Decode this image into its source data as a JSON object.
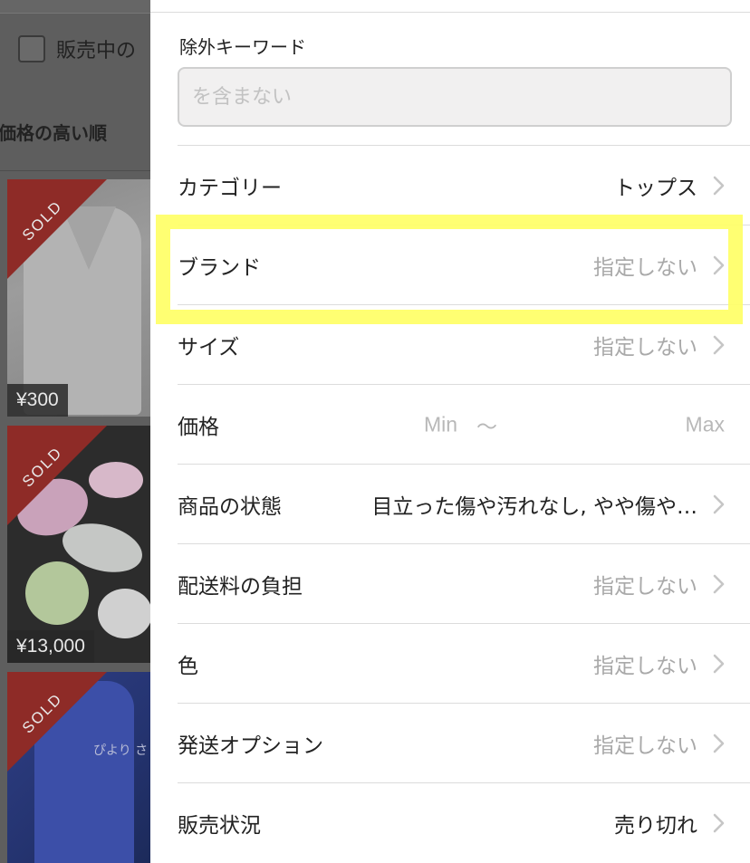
{
  "background": {
    "filter_checkbox_label": "販売中の",
    "sort_label": "価格の高い順",
    "items": [
      {
        "badge": "SOLD",
        "price": "¥300"
      },
      {
        "badge": "SOLD",
        "price": "¥13,000"
      },
      {
        "badge": "SOLD",
        "overlay_text": "ぴより さ"
      }
    ]
  },
  "filter_panel": {
    "exclude_keyword": {
      "label": "除外キーワード",
      "placeholder": "を含まない",
      "value": ""
    },
    "rows": {
      "category": {
        "label": "カテゴリー",
        "value": "トップス"
      },
      "brand": {
        "label": "ブランド",
        "value": "指定しない"
      },
      "size": {
        "label": "サイズ",
        "value": "指定しない"
      },
      "price": {
        "label": "価格",
        "min_placeholder": "Min",
        "separator": "〜",
        "max_placeholder": "Max"
      },
      "condition": {
        "label": "商品の状態",
        "value": "目立った傷や汚れなし, やや傷や…"
      },
      "shipping_fee": {
        "label": "配送料の負担",
        "value": "指定しない"
      },
      "color": {
        "label": "色",
        "value": "指定しない"
      },
      "shipping_option": {
        "label": "発送オプション",
        "value": "指定しない"
      },
      "sales_status": {
        "label": "販売状況",
        "value": "売り切れ"
      }
    }
  },
  "colors": {
    "highlight": "#ffff66",
    "sold_ribbon": "#8e2b27",
    "unset_value_text": "#a9a9a9"
  },
  "icons": [
    "chevron-right-icon",
    "checkbox-icon"
  ]
}
